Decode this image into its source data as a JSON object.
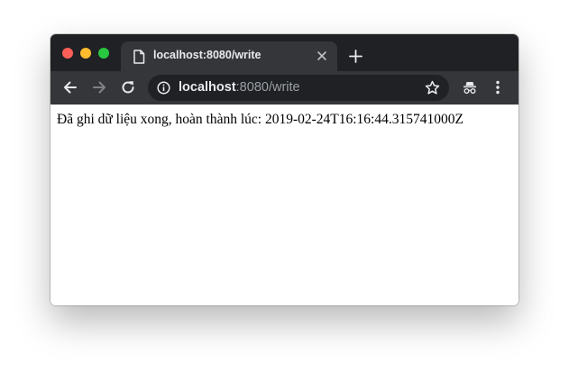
{
  "tab": {
    "title": "localhost:8080/write"
  },
  "address_bar": {
    "host": "localhost",
    "path": ":8080/write"
  },
  "page": {
    "body_text": "Đã ghi dữ liệu xong, hoàn thành lúc: 2019-02-24T16:16:44.315741000Z"
  },
  "icons": {
    "tab_favicon": "document-icon",
    "tab_close": "close-icon",
    "new_tab": "plus-icon",
    "back": "arrow-left-icon",
    "forward": "arrow-right-icon",
    "reload": "reload-icon",
    "site_info": "info-icon",
    "bookmark": "star-icon",
    "incognito": "incognito-icon",
    "menu": "kebab-menu-icon"
  },
  "colors": {
    "tabstrip": "#202124",
    "active_tab": "#35363a",
    "omnibox": "#202124",
    "close_light": "#fe5f57",
    "minimize_light": "#febc2e",
    "maximize_light": "#28c840"
  }
}
